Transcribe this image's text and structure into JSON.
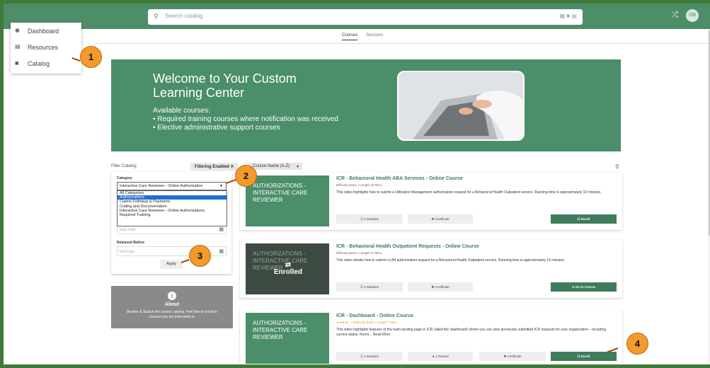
{
  "search": {
    "placeholder": "Search catalog"
  },
  "user": {
    "initials": "OB"
  },
  "nav": {
    "items": [
      {
        "label": "Dashboard",
        "icon": "dashboard-icon"
      },
      {
        "label": "Resources",
        "icon": "document-icon"
      },
      {
        "label": "Catalog",
        "icon": "folder-icon"
      }
    ]
  },
  "tabs": [
    {
      "label": "Courses",
      "active": true
    },
    {
      "label": "Sessions",
      "active": false
    }
  ],
  "banner": {
    "title": "Welcome to Your Custom Learning Center",
    "subtitle": "Available courses:",
    "bullets": [
      "• Required training courses where notification was received",
      "• Elective administrative support courses"
    ]
  },
  "filter": {
    "label": "Filter Catalog",
    "enabled": "Filtering Enabled",
    "sort": "Course Name (A-Z)"
  },
  "category": {
    "label": "Category",
    "value": "Interactive Care Reviewer - Online Authorization",
    "options": [
      "All Categories",
      "Authorizations",
      "Claims Followup & Payments",
      "Coding and Documentation",
      "Interactive Care Reviewer - Online Authorizations",
      "Required Training"
    ],
    "selected_index": 1
  },
  "released_after": {
    "placeholder": "Start Date"
  },
  "released_before": {
    "label": "Released Before",
    "placeholder": "End Date"
  },
  "apply": "Apply",
  "about": {
    "title": "About",
    "text": "Browse & Search the course catalog. Feel free to enroll in courses you are interested in."
  },
  "courses": [
    {
      "thumb": "AUTHORIZATIONS - INTERACTIVE CARE REVIEWER",
      "title": "ICR - Behavioral Health ABA Services - Online Course",
      "meta": "Difficulty Basic  •  Length 10 Mins",
      "desc": "This video highlights how to submit a Utilization Management authorization request for a Behavioral Health Outpatient service. Running time is approximately 10 minutes.",
      "buttons": [
        "2 Modules",
        "Certificate"
      ],
      "action": "Enroll",
      "enrolled": false
    },
    {
      "thumb": "AUTHORIZATIONS - INTERACTIVE CARE REVIEWER",
      "title": "ICR - Behavioral Health Outpatient Requests - Online Course",
      "meta": "Difficulty Basic  •  Length 14 Mins",
      "desc": "This video details how to submit a UM authorization request for a Behavioral Health Outpatient service. Running time is approximately 14 minutes.",
      "buttons": [
        "4 Modules",
        "Certificate"
      ],
      "action": "Go to Course",
      "enrolled": true,
      "badge": "Enrolled"
    },
    {
      "thumb": "AUTHORIZATIONS - INTERACTIVE CARE REVIEWER",
      "title": "ICR - Dashboard - Online Course",
      "meta": "★★★★☆  •  Difficulty Basic  •  Length 7 Mins",
      "desc": "This video highlights features of the main landing page in ICR called the 'dashboard' where you can view previously submitted ICR requests for your organization – including current status.  Runni... Read More",
      "buttons": [
        "2 Modules",
        "1 Review",
        "Certificate"
      ],
      "action": "Enroll",
      "enrolled": false
    }
  ],
  "markers": [
    "1",
    "2",
    "3",
    "4"
  ],
  "colors": {
    "brand": "#4b8e6a",
    "button": "#3e7c5c",
    "marker": "#f39a2b",
    "frame": "#3f7a38"
  }
}
